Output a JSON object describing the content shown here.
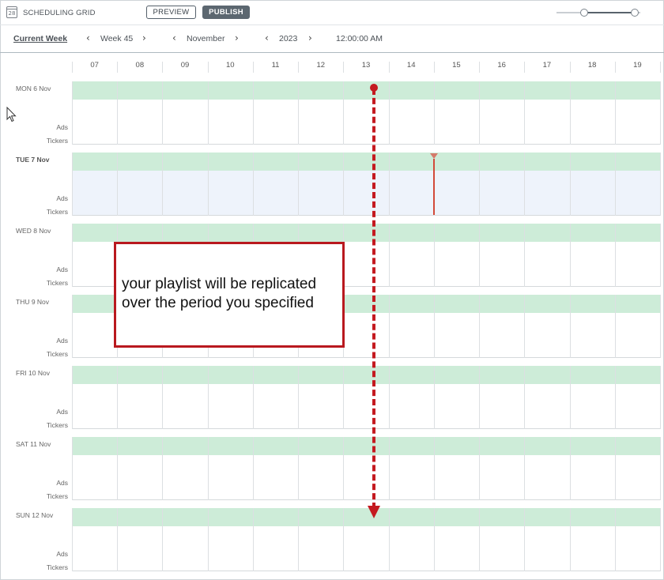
{
  "app": {
    "title": "SCHEDULING GRID",
    "icon_text": "28",
    "icon": "calendar-icon"
  },
  "toolbar": {
    "preview_label": "PREVIEW",
    "publish_label": "PUBLISH"
  },
  "nav": {
    "current_week": "Current Week",
    "week": "Week 45",
    "month": "November",
    "year": "2023",
    "time": "12:00:00 AM"
  },
  "hours": [
    "07",
    "08",
    "09",
    "10",
    "11",
    "12",
    "13",
    "14",
    "15",
    "16",
    "17",
    "18",
    "19"
  ],
  "days": [
    {
      "name": "MON 6 Nov",
      "ads": "Ads",
      "tickers": "Tickers"
    },
    {
      "name": "TUE 7 Nov",
      "ads": "Ads",
      "tickers": "Tickers"
    },
    {
      "name": "WED 8 Nov",
      "ads": "Ads",
      "tickers": "Tickers"
    },
    {
      "name": "THU 9 Nov",
      "ads": "Ads",
      "tickers": "Tickers"
    },
    {
      "name": "FRI 10 Nov",
      "ads": "Ads",
      "tickers": "Tickers"
    },
    {
      "name": "SAT 11 Nov",
      "ads": "Ads",
      "tickers": "Tickers"
    },
    {
      "name": "SUN 12 Nov",
      "ads": "Ads",
      "tickers": "Tickers"
    }
  ],
  "annotation": {
    "text": "your playlist will be replicated over the period you specified"
  },
  "colors": {
    "band": "#cdecd8",
    "today_body": "#eef3fb",
    "annotation_red": "#c41a20",
    "now_marker": "#d24a3a"
  }
}
